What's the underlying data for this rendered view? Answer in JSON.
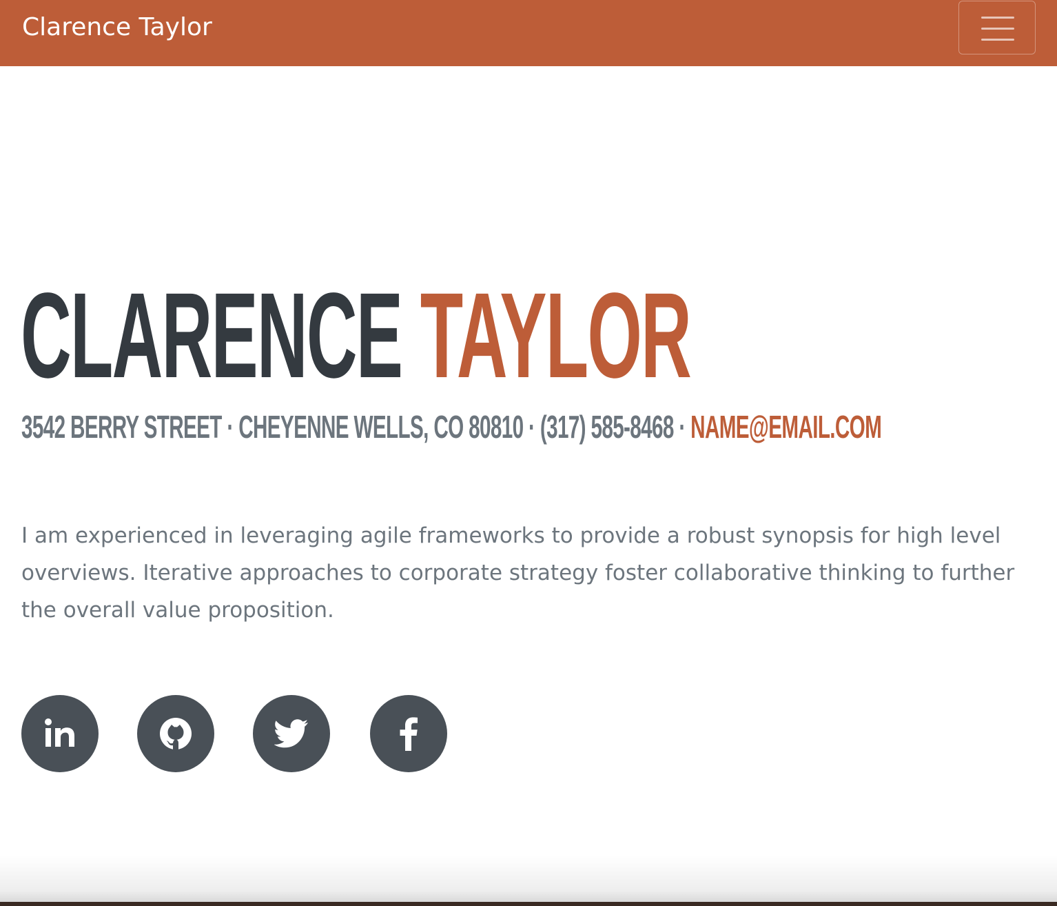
{
  "navbar": {
    "brand": "Clarence Taylor",
    "background_color": "#bd5d38",
    "toggle_icon": "hamburger-menu-icon"
  },
  "about": {
    "first_name": "Clarence",
    "last_name": "Taylor",
    "address_line": "3542 Berry Street · Cheyenne Wells, CO 80810 · (317) 585-8468 · ",
    "email": "name@email.com",
    "bio": "I am experienced in leveraging agile frameworks to provide a robust synopsis for high level overviews. Iterative approaches to corporate strategy foster collaborative thinking to further the overall value proposition."
  },
  "social": [
    {
      "network": "LinkedIn",
      "icon": "linkedin-icon"
    },
    {
      "network": "GitHub",
      "icon": "github-icon"
    },
    {
      "network": "Twitter",
      "icon": "twitter-icon"
    },
    {
      "network": "Facebook",
      "icon": "facebook-icon"
    }
  ],
  "colors": {
    "accent": "#bd5d38",
    "heading_dark": "#343a40",
    "muted_text": "#6c757d",
    "social_button": "#495057"
  }
}
